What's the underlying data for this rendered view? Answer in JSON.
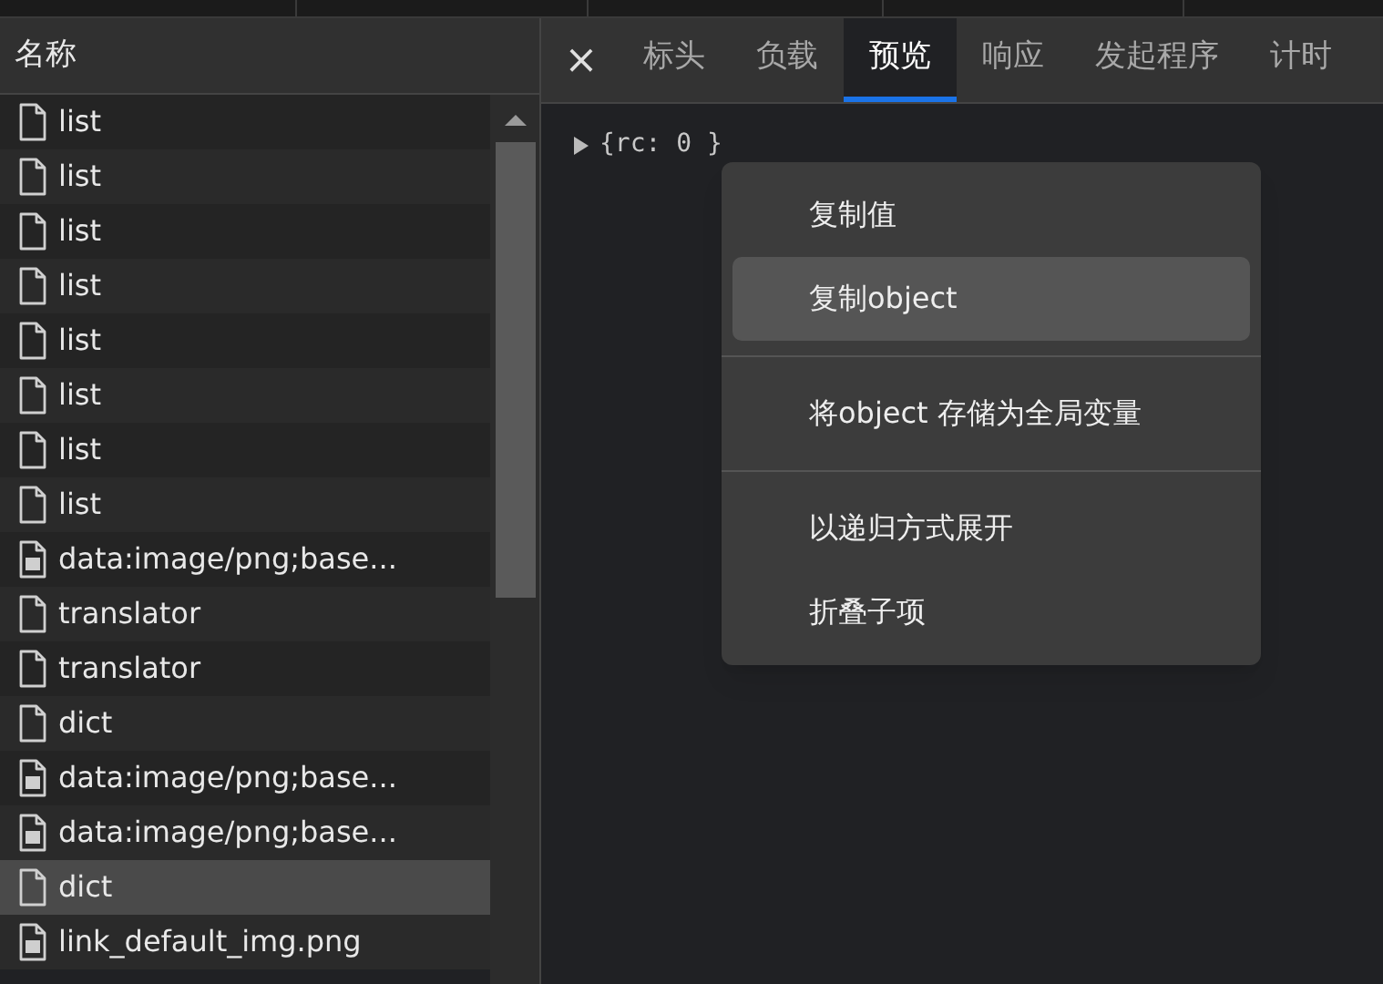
{
  "name_column": {
    "header": "名称"
  },
  "requests": [
    {
      "name": "list",
      "kind": "file",
      "selected": false
    },
    {
      "name": "list",
      "kind": "file",
      "selected": false
    },
    {
      "name": "list",
      "kind": "file",
      "selected": false
    },
    {
      "name": "list",
      "kind": "file",
      "selected": false
    },
    {
      "name": "list",
      "kind": "file",
      "selected": false
    },
    {
      "name": "list",
      "kind": "file",
      "selected": false
    },
    {
      "name": "list",
      "kind": "file",
      "selected": false
    },
    {
      "name": "list",
      "kind": "file",
      "selected": false
    },
    {
      "name": "data:image/png;base...",
      "kind": "image",
      "selected": false
    },
    {
      "name": "translator",
      "kind": "file",
      "selected": false
    },
    {
      "name": "translator",
      "kind": "file",
      "selected": false
    },
    {
      "name": "dict",
      "kind": "file",
      "selected": false
    },
    {
      "name": "data:image/png;base...",
      "kind": "image",
      "selected": false
    },
    {
      "name": "data:image/png;base...",
      "kind": "image",
      "selected": false
    },
    {
      "name": "dict",
      "kind": "file",
      "selected": true
    },
    {
      "name": "link_default_img.png",
      "kind": "image",
      "selected": false
    }
  ],
  "close_button": "×",
  "tabs": [
    {
      "label": "标头",
      "selected": false
    },
    {
      "label": "负载",
      "selected": false
    },
    {
      "label": "预览",
      "selected": true
    },
    {
      "label": "响应",
      "selected": false
    },
    {
      "label": "发起程序",
      "selected": false
    },
    {
      "label": "计时",
      "selected": false
    }
  ],
  "preview": {
    "text": "{rc: 0 }",
    "expanded": false
  },
  "context_menu": [
    {
      "kind": "item",
      "label": "复制值",
      "highlighted": false
    },
    {
      "kind": "item",
      "label": "复制object",
      "highlighted": true
    },
    {
      "kind": "separator"
    },
    {
      "kind": "item",
      "label": "将object 存储为全局变量",
      "highlighted": false
    },
    {
      "kind": "separator"
    },
    {
      "kind": "item",
      "label": "以递归方式展开",
      "highlighted": false
    },
    {
      "kind": "item",
      "label": "折叠子项",
      "highlighted": false
    }
  ]
}
